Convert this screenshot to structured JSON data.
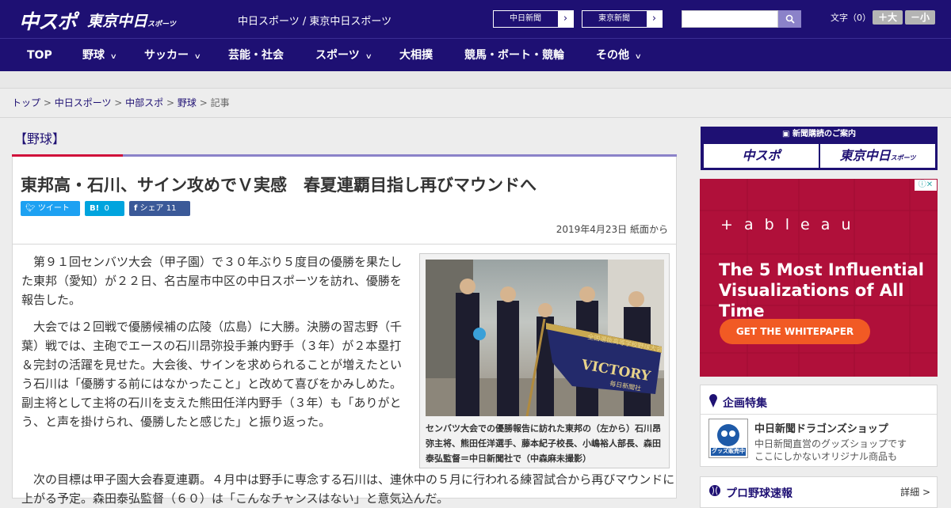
{
  "header": {
    "logo_chusupo": "中スポ",
    "logo_tokyo": "東京中日",
    "logo_tokyo_small": "スポーツ",
    "site_name": "中日スポーツ / 東京中日スポーツ",
    "link_chunichi": "中日新聞",
    "link_tokyo": "東京新聞",
    "font_label": "文字（0）",
    "font_larger": "＋大",
    "font_smaller": "－小"
  },
  "nav": [
    {
      "label": "TOP",
      "chev": false
    },
    {
      "label": "野球",
      "chev": true
    },
    {
      "label": "サッカー",
      "chev": true
    },
    {
      "label": "芸能・社会",
      "chev": false
    },
    {
      "label": "スポーツ",
      "chev": true
    },
    {
      "label": "大相撲",
      "chev": false
    },
    {
      "label": "競馬・ボート・競輪",
      "chev": false
    },
    {
      "label": "その他",
      "chev": true
    }
  ],
  "breadcrumb": {
    "top": "トップ",
    "chunichi_sports": "中日スポーツ",
    "chubu": "中部スポ",
    "baseball": "野球",
    "article": "記事",
    "sep": " > "
  },
  "category": "【野球】",
  "article": {
    "headline": "東邦高・石川、サイン攻めでＶ実感　春夏連覇目指し再びマウンドへ",
    "share": {
      "tweet": "ツイート",
      "hatena": "B!",
      "hatena_count": "0",
      "facebook": "シェア",
      "facebook_count": "11"
    },
    "date": "2019年4月23日 紙面から",
    "paragraphs": [
      "第９１回センバツ大会（甲子園）で３０年ぶり５度目の優勝を果たした東邦（愛知）が２２日、名古屋市中区の中日スポーツを訪れ、優勝を報告した。",
      "大会では２回戦で優勝候補の広陵（広島）に大勝。決勝の習志野（千葉）戦では、主砲でエースの石川昂弥投手兼内野手（３年）が２本塁打＆完封の活躍を見せた。大会後、サインを求められることが増えたという石川は「優勝する前にはなかったこと」と改めて喜びをかみしめた。副主将として主将の石川を支えた熊田任洋内野手（３年）も「ありがとう、と声を掛けられ、優勝したと感じた」と振り返った。"
    ],
    "tail": "次の目標は甲子園大会春夏連覇。４月中は野手に専念する石川は、連休中の５月に行われる練習試合から再びマウンドに上がる予定。森田泰弘監督（６０）は「こんなチャンスはない」と意気込んだ。",
    "photo_caption": "センバツ大会での優勝報告に訪れた東邦の（左から）石川昂弥主将、熊田任洋選手、藤本紀子校長、小嶋裕人部長、森田泰弘監督＝中日新聞社で（中森麻未撮影）",
    "flag_text": "VICTORY",
    "flag_sub": "全国選抜高等学校野球大会",
    "flag_bottom": "毎日新聞社"
  },
  "sidebar": {
    "subscribe_title": "新聞購読のご案内",
    "subscribe_chusupo": "中スポ",
    "subscribe_tokyo": "東京中日",
    "subscribe_tokyo_small": "スポーツ",
    "ad": {
      "brand": "+ a b l e a u",
      "headline": "The 5 Most Influential Visualizations of All Time",
      "cta": "GET THE WHITEPAPER",
      "info": "ⓘ✕"
    },
    "feature_title": "企画特集",
    "feature_item_title": "中日新聞ドラゴンズショップ",
    "feature_item_line1": "中日新聞直営のグッズショップです",
    "feature_item_line2": "ここにしかないオリジナル商品も",
    "feature_thumb_text": "グッズ販売中",
    "baseball_title": "プロ野球速報",
    "baseball_more": "詳細 >"
  },
  "colors": {
    "brand": "#1e1073",
    "accent_red": "#d0103a",
    "ad_bg": "#b0103a",
    "ad_button": "#f15a24",
    "twitter": "#1da1f2",
    "hatena": "#00a4de",
    "facebook": "#3b5998"
  }
}
